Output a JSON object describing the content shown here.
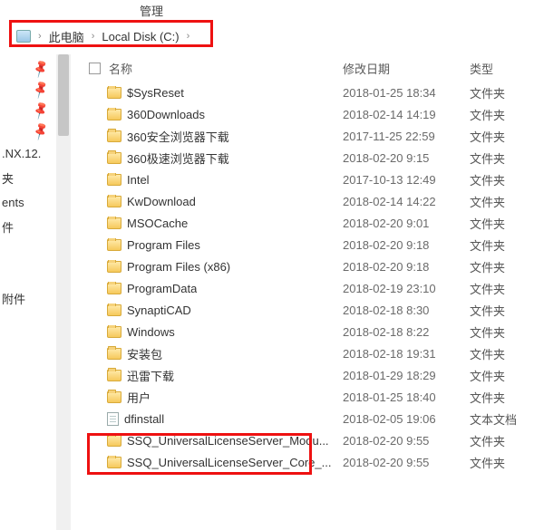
{
  "ribbon_tab": "管理",
  "breadcrumb": {
    "seg1": "此电脑",
    "seg2": "Local Disk (C:)"
  },
  "sidebar_cut_labels": [
    ".NX.12.",
    "夹",
    "ents",
    "件",
    "附件"
  ],
  "columns": {
    "name": "名称",
    "date": "修改日期",
    "type": "类型"
  },
  "type_folder": "文件夹",
  "type_textdoc": "文本文档",
  "rows": [
    {
      "icon": "folder",
      "name": "$SysReset",
      "date": "2018-01-25 18:34",
      "type": "文件夹"
    },
    {
      "icon": "folder",
      "name": "360Downloads",
      "date": "2018-02-14 14:19",
      "type": "文件夹"
    },
    {
      "icon": "folder",
      "name": "360安全浏览器下载",
      "date": "2017-11-25 22:59",
      "type": "文件夹"
    },
    {
      "icon": "folder",
      "name": "360极速浏览器下载",
      "date": "2018-02-20 9:15",
      "type": "文件夹"
    },
    {
      "icon": "folder",
      "name": "Intel",
      "date": "2017-10-13 12:49",
      "type": "文件夹"
    },
    {
      "icon": "folder",
      "name": "KwDownload",
      "date": "2018-02-14 14:22",
      "type": "文件夹"
    },
    {
      "icon": "folder",
      "name": "MSOCache",
      "date": "2018-02-20 9:01",
      "type": "文件夹"
    },
    {
      "icon": "folder",
      "name": "Program Files",
      "date": "2018-02-20 9:18",
      "type": "文件夹"
    },
    {
      "icon": "folder",
      "name": "Program Files (x86)",
      "date": "2018-02-20 9:18",
      "type": "文件夹"
    },
    {
      "icon": "folder",
      "name": "ProgramData",
      "date": "2018-02-19 23:10",
      "type": "文件夹"
    },
    {
      "icon": "folder",
      "name": "SynaptiCAD",
      "date": "2018-02-18 8:30",
      "type": "文件夹"
    },
    {
      "icon": "folder",
      "name": "Windows",
      "date": "2018-02-18 8:22",
      "type": "文件夹"
    },
    {
      "icon": "folder",
      "name": "安装包",
      "date": "2018-02-18 19:31",
      "type": "文件夹"
    },
    {
      "icon": "folder",
      "name": "迅雷下载",
      "date": "2018-01-29 18:29",
      "type": "文件夹"
    },
    {
      "icon": "folder",
      "name": "用户",
      "date": "2018-01-25 18:40",
      "type": "文件夹"
    },
    {
      "icon": "file",
      "name": "dfinstall",
      "date": "2018-02-05 19:06",
      "type": "文本文档"
    },
    {
      "icon": "folder",
      "name": "SSQ_UniversalLicenseServer_Modu...",
      "date": "2018-02-20 9:55",
      "type": "文件夹"
    },
    {
      "icon": "folder",
      "name": "SSQ_UniversalLicenseServer_Core_...",
      "date": "2018-02-20 9:55",
      "type": "文件夹"
    }
  ]
}
